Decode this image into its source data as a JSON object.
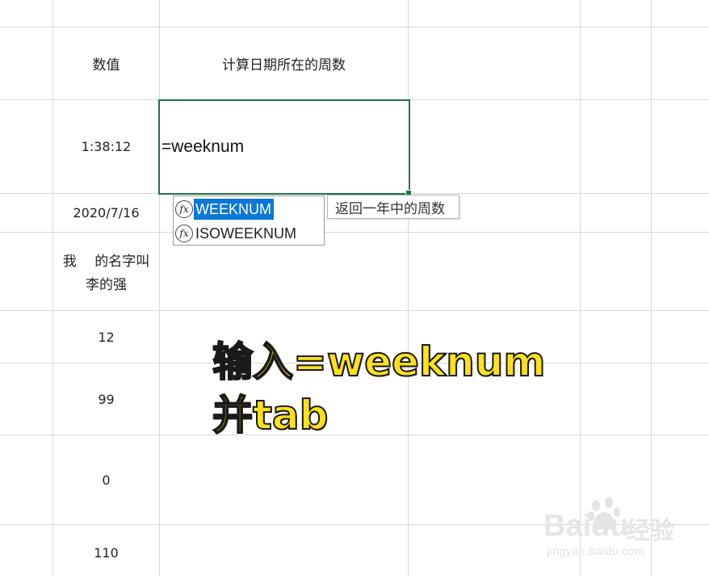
{
  "cells": {
    "header_a": "数值",
    "header_b": "计算日期所在的周数",
    "a_time": "1:38:12",
    "a_date": "2020/7/16",
    "a_text_line1": "我　 的名字叫",
    "a_text_line2": "李的强",
    "a_12": "12",
    "a_99": "99",
    "a_0": "0",
    "a_110": "110"
  },
  "formula_input": "=weeknum",
  "autocomplete": {
    "items": [
      {
        "label": "WEEKNUM",
        "icon": "fx-icon",
        "selected": true
      },
      {
        "label": "ISOWEEKNUM",
        "icon": "fx-icon",
        "selected": false
      }
    ],
    "tooltip": "返回一年中的周数"
  },
  "annotation": {
    "line1": "输入=weeknum",
    "line2": "并tab"
  },
  "watermark": {
    "logo": "Baidu",
    "cn": "经验",
    "url": "jingyan.baidu.com"
  },
  "colors": {
    "active_border": "#217346",
    "selection": "#0a78d4",
    "annotation_fill": "#ffe11a"
  }
}
